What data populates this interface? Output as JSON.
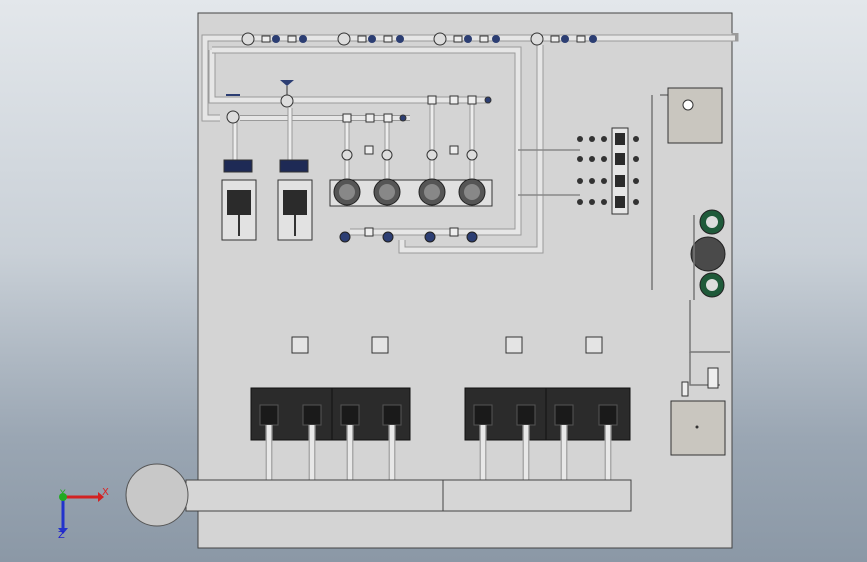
{
  "viewport": {
    "background_top": "#e3e7eb",
    "background_bottom": "#8b98a6",
    "panel_color": "#d4d4d4",
    "pipe_color": "#e2e2e2",
    "unit_color": "#2b2b2b",
    "valve_accent": "#2c3e73",
    "filter_green": "#1f5a3a"
  },
  "triad": {
    "x_label": "X",
    "y_label": "Y",
    "z_label": "Z",
    "x_color": "#d22222",
    "y_color": "#22aa22",
    "z_color": "#2233cc"
  },
  "model": {
    "pumps_top_count": 4,
    "unit_blocks_count": 4,
    "filters_count": 3,
    "valve_manifold_rows": 4
  }
}
